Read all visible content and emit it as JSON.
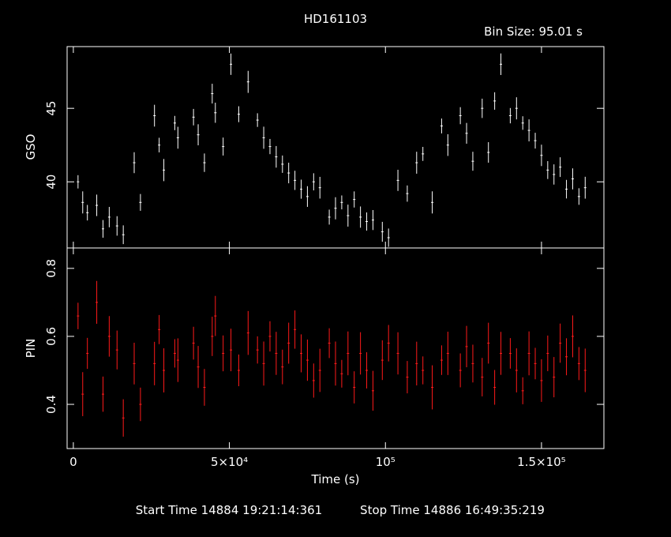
{
  "chart_data": {
    "type": "line",
    "title": "HD161103",
    "bin_size": "Bin Size: 95.01 s",
    "xlabel": "Time (s)",
    "x_ticks": [
      {
        "value": 0,
        "label": "0"
      },
      {
        "value": 50000,
        "label": "5×10⁴"
      },
      {
        "value": 100000,
        "label": "10⁵"
      },
      {
        "value": 150000,
        "label": "1.5×10⁵"
      }
    ],
    "xlim": [
      -2000,
      170000
    ],
    "footer": {
      "start": "Start Time 14884 19:21:14:361",
      "stop": "Stop Time 14886 16:49:35:219"
    },
    "panels": [
      {
        "ylabel": "GSO",
        "color": "#ffffff",
        "ylim": [
          35.5,
          49.2
        ],
        "y_ticks": [
          {
            "value": 40,
            "label": "40"
          },
          {
            "value": 45,
            "label": "45"
          }
        ],
        "series": [
          {
            "x": 1500,
            "y": 40.0
          },
          {
            "x": 3000,
            "y": 38.6
          },
          {
            "x": 4500,
            "y": 37.9
          },
          {
            "x": 7500,
            "y": 38.4
          },
          {
            "x": 9500,
            "y": 36.8
          },
          {
            "x": 11500,
            "y": 37.6
          },
          {
            "x": 14000,
            "y": 37.0
          },
          {
            "x": 16000,
            "y": 36.4
          },
          {
            "x": 19500,
            "y": 41.3
          },
          {
            "x": 21500,
            "y": 38.6
          },
          {
            "x": 26000,
            "y": 44.5
          },
          {
            "x": 27500,
            "y": 42.5
          },
          {
            "x": 29000,
            "y": 40.8
          },
          {
            "x": 32500,
            "y": 44.0
          },
          {
            "x": 33500,
            "y": 43.0
          },
          {
            "x": 38500,
            "y": 44.4
          },
          {
            "x": 40000,
            "y": 43.2
          },
          {
            "x": 42000,
            "y": 41.3
          },
          {
            "x": 44500,
            "y": 46.0
          },
          {
            "x": 45500,
            "y": 44.7
          },
          {
            "x": 48000,
            "y": 42.4
          },
          {
            "x": 50500,
            "y": 48.0
          },
          {
            "x": 53000,
            "y": 44.6
          },
          {
            "x": 56000,
            "y": 46.8
          },
          {
            "x": 59000,
            "y": 44.2
          },
          {
            "x": 61000,
            "y": 43.0
          },
          {
            "x": 63000,
            "y": 42.4
          },
          {
            "x": 65000,
            "y": 41.7
          },
          {
            "x": 67000,
            "y": 41.2
          },
          {
            "x": 69000,
            "y": 40.6
          },
          {
            "x": 71000,
            "y": 40.1
          },
          {
            "x": 73000,
            "y": 39.5
          },
          {
            "x": 75000,
            "y": 39.0
          },
          {
            "x": 77000,
            "y": 40.0
          },
          {
            "x": 79000,
            "y": 39.6
          },
          {
            "x": 82000,
            "y": 37.6
          },
          {
            "x": 84000,
            "y": 38.2
          },
          {
            "x": 86000,
            "y": 38.6
          },
          {
            "x": 88000,
            "y": 37.7
          },
          {
            "x": 90000,
            "y": 38.8
          },
          {
            "x": 92000,
            "y": 37.6
          },
          {
            "x": 94000,
            "y": 37.3
          },
          {
            "x": 96000,
            "y": 37.4
          },
          {
            "x": 99000,
            "y": 36.6
          },
          {
            "x": 101000,
            "y": 36.2
          },
          {
            "x": 104000,
            "y": 40.1
          },
          {
            "x": 107000,
            "y": 39.2
          },
          {
            "x": 110000,
            "y": 41.3
          },
          {
            "x": 112000,
            "y": 41.9
          },
          {
            "x": 115000,
            "y": 38.6
          },
          {
            "x": 118000,
            "y": 43.8
          },
          {
            "x": 120000,
            "y": 42.5
          },
          {
            "x": 124000,
            "y": 44.5
          },
          {
            "x": 126000,
            "y": 43.3
          },
          {
            "x": 128000,
            "y": 41.4
          },
          {
            "x": 131000,
            "y": 45.0
          },
          {
            "x": 133000,
            "y": 42.0
          },
          {
            "x": 135000,
            "y": 45.5
          },
          {
            "x": 137000,
            "y": 48.0
          },
          {
            "x": 140000,
            "y": 44.5
          },
          {
            "x": 142000,
            "y": 45.0
          },
          {
            "x": 144000,
            "y": 44.0
          },
          {
            "x": 146000,
            "y": 43.5
          },
          {
            "x": 148000,
            "y": 42.8
          },
          {
            "x": 150000,
            "y": 41.8
          },
          {
            "x": 152000,
            "y": 40.8
          },
          {
            "x": 154000,
            "y": 40.5
          },
          {
            "x": 156000,
            "y": 41.0
          },
          {
            "x": 158000,
            "y": 39.5
          },
          {
            "x": 160000,
            "y": 40.2
          },
          {
            "x": 162000,
            "y": 39.0
          },
          {
            "x": 164000,
            "y": 39.6
          }
        ]
      },
      {
        "ylabel": "PIN",
        "color": "#ff1a1a",
        "ylim": [
          0.27,
          0.86
        ],
        "y_ticks": [
          {
            "value": 0.4,
            "label": "0.4"
          },
          {
            "value": 0.6,
            "label": "0.6"
          },
          {
            "value": 0.8,
            "label": "0.8"
          }
        ],
        "series": [
          {
            "x": 1500,
            "y": 0.66
          },
          {
            "x": 3000,
            "y": 0.43
          },
          {
            "x": 4500,
            "y": 0.55
          },
          {
            "x": 7500,
            "y": 0.7
          },
          {
            "x": 9500,
            "y": 0.43
          },
          {
            "x": 11500,
            "y": 0.6
          },
          {
            "x": 14000,
            "y": 0.56
          },
          {
            "x": 16000,
            "y": 0.36
          },
          {
            "x": 19500,
            "y": 0.52
          },
          {
            "x": 21500,
            "y": 0.4
          },
          {
            "x": 26000,
            "y": 0.52
          },
          {
            "x": 27500,
            "y": 0.62
          },
          {
            "x": 29000,
            "y": 0.5
          },
          {
            "x": 32500,
            "y": 0.55
          },
          {
            "x": 33500,
            "y": 0.53
          },
          {
            "x": 38500,
            "y": 0.58
          },
          {
            "x": 40000,
            "y": 0.51
          },
          {
            "x": 42000,
            "y": 0.45
          },
          {
            "x": 44500,
            "y": 0.6
          },
          {
            "x": 45500,
            "y": 0.66
          },
          {
            "x": 48000,
            "y": 0.55
          },
          {
            "x": 50500,
            "y": 0.56
          },
          {
            "x": 53000,
            "y": 0.5
          },
          {
            "x": 56000,
            "y": 0.61
          },
          {
            "x": 59000,
            "y": 0.56
          },
          {
            "x": 61000,
            "y": 0.52
          },
          {
            "x": 63000,
            "y": 0.6
          },
          {
            "x": 65000,
            "y": 0.55
          },
          {
            "x": 67000,
            "y": 0.51
          },
          {
            "x": 69000,
            "y": 0.58
          },
          {
            "x": 71000,
            "y": 0.62
          },
          {
            "x": 73000,
            "y": 0.55
          },
          {
            "x": 75000,
            "y": 0.53
          },
          {
            "x": 77000,
            "y": 0.47
          },
          {
            "x": 79000,
            "y": 0.5
          },
          {
            "x": 82000,
            "y": 0.58
          },
          {
            "x": 84000,
            "y": 0.52
          },
          {
            "x": 86000,
            "y": 0.49
          },
          {
            "x": 88000,
            "y": 0.55
          },
          {
            "x": 90000,
            "y": 0.45
          },
          {
            "x": 92000,
            "y": 0.55
          },
          {
            "x": 94000,
            "y": 0.5
          },
          {
            "x": 96000,
            "y": 0.44
          },
          {
            "x": 99000,
            "y": 0.53
          },
          {
            "x": 101000,
            "y": 0.58
          },
          {
            "x": 104000,
            "y": 0.55
          },
          {
            "x": 107000,
            "y": 0.48
          },
          {
            "x": 110000,
            "y": 0.52
          },
          {
            "x": 112000,
            "y": 0.5
          },
          {
            "x": 115000,
            "y": 0.45
          },
          {
            "x": 118000,
            "y": 0.53
          },
          {
            "x": 120000,
            "y": 0.55
          },
          {
            "x": 124000,
            "y": 0.5
          },
          {
            "x": 126000,
            "y": 0.57
          },
          {
            "x": 128000,
            "y": 0.52
          },
          {
            "x": 131000,
            "y": 0.48
          },
          {
            "x": 133000,
            "y": 0.58
          },
          {
            "x": 135000,
            "y": 0.45
          },
          {
            "x": 137000,
            "y": 0.55
          },
          {
            "x": 140000,
            "y": 0.55
          },
          {
            "x": 142000,
            "y": 0.5
          },
          {
            "x": 144000,
            "y": 0.44
          },
          {
            "x": 146000,
            "y": 0.55
          },
          {
            "x": 148000,
            "y": 0.52
          },
          {
            "x": 150000,
            "y": 0.47
          },
          {
            "x": 152000,
            "y": 0.55
          },
          {
            "x": 154000,
            "y": 0.48
          },
          {
            "x": 156000,
            "y": 0.58
          },
          {
            "x": 158000,
            "y": 0.54
          },
          {
            "x": 160000,
            "y": 0.6
          },
          {
            "x": 162000,
            "y": 0.52
          },
          {
            "x": 164000,
            "y": 0.5
          }
        ]
      }
    ]
  }
}
